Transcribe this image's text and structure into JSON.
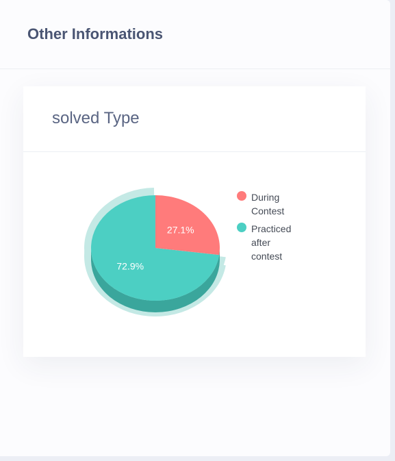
{
  "section": {
    "title": "Other Informations"
  },
  "card": {
    "title": "solved Type"
  },
  "colors": {
    "during": "#ff7b7b",
    "practiced": "#4ccfc3",
    "practiced_dark": "#3aa69c",
    "highlight": "#c4e9e5"
  },
  "chart_data": {
    "type": "pie",
    "title": "solved Type",
    "labels": [
      "During Contest",
      "Practiced after contest"
    ],
    "values": [
      27.1,
      72.9
    ],
    "value_labels": [
      "27.1%",
      "72.9%"
    ],
    "legend": "right",
    "selected": "Practiced after contest"
  }
}
